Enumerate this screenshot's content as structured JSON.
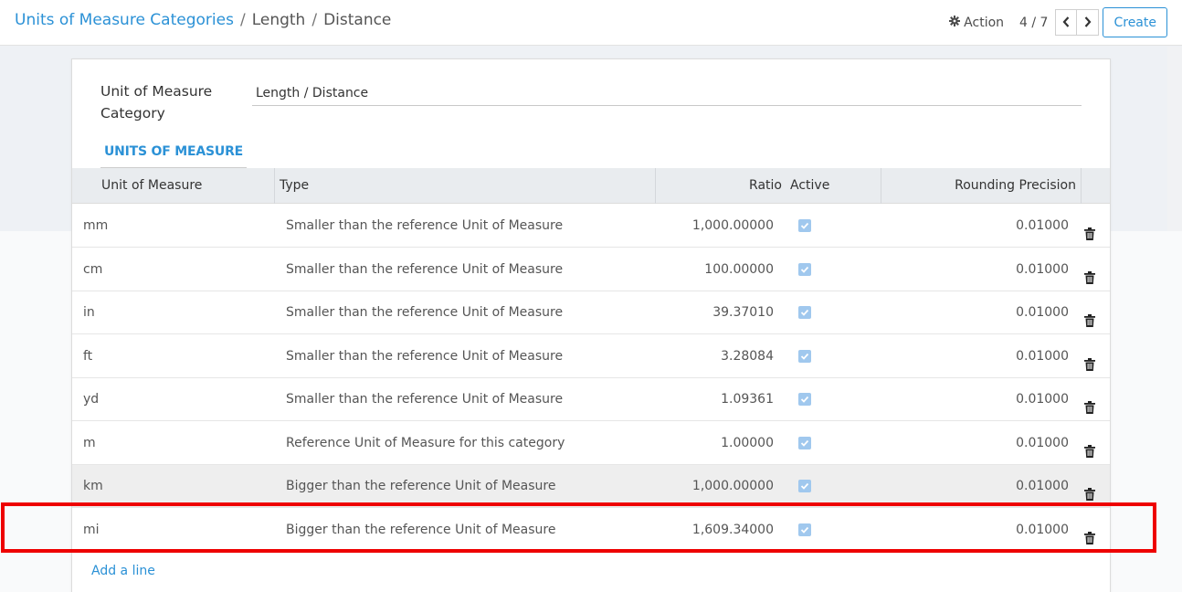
{
  "breadcrumb": {
    "parent": "Units of Measure Categories",
    "separator1": "/",
    "record": "Length",
    "separator2": "/",
    "current": "Distance"
  },
  "control": {
    "action_label": "Action",
    "action_icon": "gear-icon",
    "pager_value": "4 / 7",
    "create_label": "Create"
  },
  "form": {
    "category_label": "Unit of Measure Category",
    "category_value": "Length / Distance",
    "tab_label": "UNITS OF MEASURE"
  },
  "table": {
    "columns": [
      "Unit of Measure",
      "Type",
      "Ratio",
      "Active",
      "Rounding Precision"
    ],
    "rows": [
      {
        "name": "mm",
        "type": "Smaller than the reference Unit of Measure",
        "ratio": "1,000.00000",
        "active": true,
        "rounding": "0.01000"
      },
      {
        "name": "cm",
        "type": "Smaller than the reference Unit of Measure",
        "ratio": "100.00000",
        "active": true,
        "rounding": "0.01000"
      },
      {
        "name": "in",
        "type": "Smaller than the reference Unit of Measure",
        "ratio": "39.37010",
        "active": true,
        "rounding": "0.01000"
      },
      {
        "name": "ft",
        "type": "Smaller than the reference Unit of Measure",
        "ratio": "3.28084",
        "active": true,
        "rounding": "0.01000"
      },
      {
        "name": "yd",
        "type": "Smaller than the reference Unit of Measure",
        "ratio": "1.09361",
        "active": true,
        "rounding": "0.01000"
      },
      {
        "name": "m",
        "type": "Reference Unit of Measure for this category",
        "ratio": "1.00000",
        "active": true,
        "rounding": "0.01000"
      },
      {
        "name": "km",
        "type": "Bigger than the reference Unit of Measure",
        "ratio": "1,000.00000",
        "active": true,
        "rounding": "0.01000"
      },
      {
        "name": "mi",
        "type": "Bigger than the reference Unit of Measure",
        "ratio": "1,609.34000",
        "active": true,
        "rounding": "0.01000"
      }
    ],
    "add_line_label": "Add a line"
  },
  "colors": {
    "accent": "#2b91d6",
    "highlight": "#ee0000",
    "checkbox": "#a0c8ee"
  }
}
